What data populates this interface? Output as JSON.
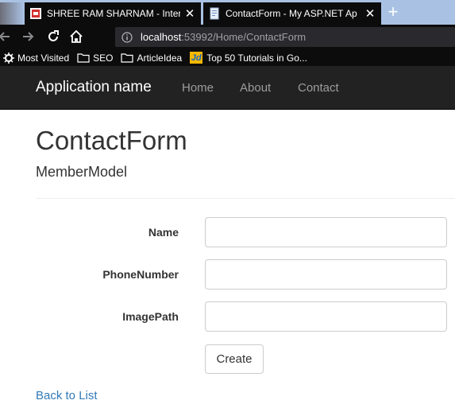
{
  "browser": {
    "tabs": [
      {
        "title": "SHREE RAM SHARNAM - Intern",
        "close": "✕"
      },
      {
        "title": "ContactForm - My ASP.NET Ap",
        "close": "✕"
      }
    ],
    "new_tab": "+",
    "url": {
      "host": "localhost",
      "rest": ":53992/Home/ContactForm"
    },
    "bookmarks": [
      {
        "label": "Most Visited",
        "icon": "gear-icon"
      },
      {
        "label": "SEO",
        "icon": "folder-icon"
      },
      {
        "label": "ArticleIdea",
        "icon": "folder-icon"
      },
      {
        "label": "Top 50 Tutorials in Go...",
        "icon": "jd-logo",
        "logo_text": "Jd"
      }
    ]
  },
  "navbar": {
    "brand": "Application name",
    "links": [
      "Home",
      "About",
      "Contact"
    ]
  },
  "page": {
    "title": "ContactForm",
    "subtitle": "MemberModel",
    "form": {
      "fields": [
        {
          "label": "Name",
          "value": ""
        },
        {
          "label": "PhoneNumber",
          "value": ""
        },
        {
          "label": "ImagePath",
          "value": ""
        }
      ],
      "submit_label": "Create"
    },
    "back_link": "Back to List"
  }
}
